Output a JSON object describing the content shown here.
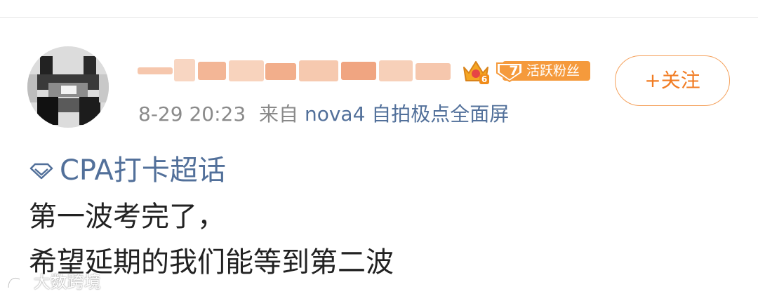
{
  "post": {
    "crown_level": "6",
    "fan_badge": {
      "level": "7",
      "label": "活跃粉丝"
    },
    "follow_label": "+关注",
    "time": "8-29 20:23",
    "from_label": "来自",
    "device": "nova4 自拍极点全面屏",
    "supertopic": "CPA打卡超话",
    "body_lines": [
      "第一波考完了，",
      "希望延期的我们能等到第二波"
    ]
  },
  "watermark": "大数跨境",
  "colors": {
    "accent_orange": "#f17c23",
    "badge_orange": "#f59a3c",
    "link_blue": "#52709a",
    "meta_gray": "#8a8a8a"
  }
}
